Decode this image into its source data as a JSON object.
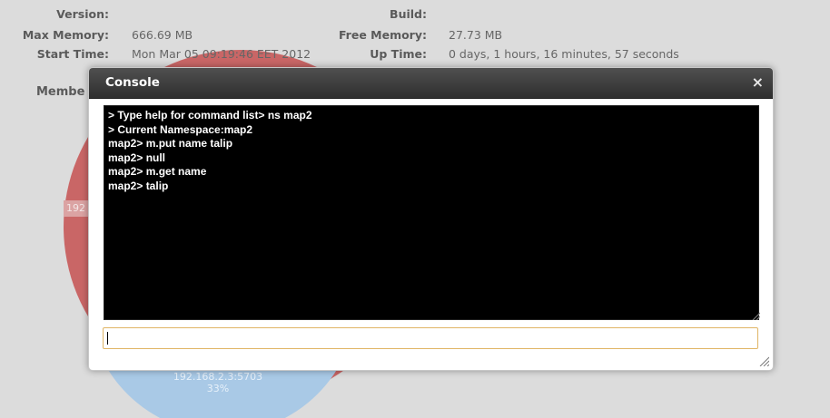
{
  "info": {
    "version_label": "Version:",
    "version_value": "",
    "build_label": "Build:",
    "build_value": "",
    "max_memory_label": "Max Memory:",
    "max_memory_value": "666.69 MB",
    "free_memory_label": "Free Memory:",
    "free_memory_value": "27.73 MB",
    "start_time_label": "Start Time:",
    "start_time_value": "Mon Mar 05 09:19:46 EET 2012",
    "up_time_label": "Up Time:",
    "up_time_value": "0 days, 1 hours, 16 minutes, 57 seconds"
  },
  "members": {
    "label": "Membe",
    "red_slice_label": "192",
    "blue_slice_ip": "192.168.2.3:5703",
    "blue_slice_pct": "33%",
    "colors": {
      "red": "#c96666",
      "blue": "#a9c9e6"
    }
  },
  "console": {
    "title": "Console",
    "close_glyph": "×",
    "lines": [
      "> Type help for command list> ns map2",
      "> Current Namespace:map2",
      "map2> m.put name talip",
      "map2> null",
      "map2> m.get name",
      "map2> talip"
    ],
    "input_value": "",
    "input_border_color": "#e0b565"
  }
}
